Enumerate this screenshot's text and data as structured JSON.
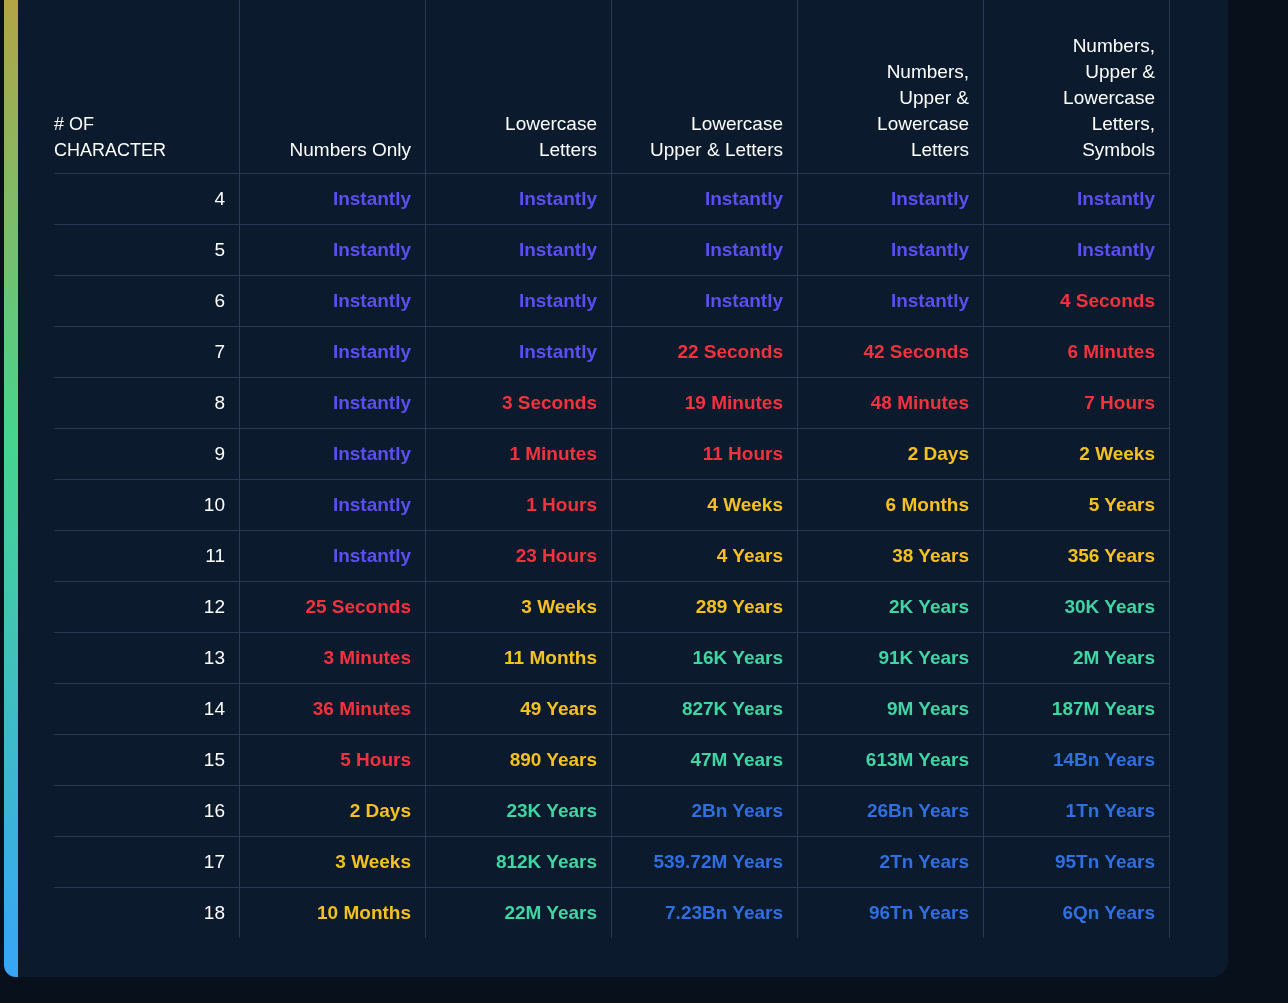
{
  "table": {
    "columns": [
      "# OF\nCHARACTER",
      "Numbers Only",
      "Lowercase\nLetters",
      "Lowercase\nUpper & Letters",
      "Numbers,\nUpper &\nLowercase\nLetters",
      "Numbers,\nUpper &\nLowercase\nLetters,\nSymbols"
    ],
    "rows": [
      {
        "cells": [
          {
            "text": "4",
            "color": "#ffffff"
          },
          {
            "text": "Instantly",
            "color": "#5b4ef2"
          },
          {
            "text": "Instantly",
            "color": "#5b4ef2"
          },
          {
            "text": "Instantly",
            "color": "#5b4ef2"
          },
          {
            "text": "Instantly",
            "color": "#5b4ef2"
          },
          {
            "text": "Instantly",
            "color": "#5b4ef2"
          }
        ]
      },
      {
        "cells": [
          {
            "text": "5",
            "color": "#ffffff"
          },
          {
            "text": "Instantly",
            "color": "#5b4ef2"
          },
          {
            "text": "Instantly",
            "color": "#5b4ef2"
          },
          {
            "text": "Instantly",
            "color": "#5b4ef2"
          },
          {
            "text": "Instantly",
            "color": "#5b4ef2"
          },
          {
            "text": "Instantly",
            "color": "#5b4ef2"
          }
        ]
      },
      {
        "cells": [
          {
            "text": "6",
            "color": "#ffffff"
          },
          {
            "text": "Instantly",
            "color": "#5b4ef2"
          },
          {
            "text": "Instantly",
            "color": "#5b4ef2"
          },
          {
            "text": "Instantly",
            "color": "#5b4ef2"
          },
          {
            "text": "Instantly",
            "color": "#5b4ef2"
          },
          {
            "text": "4 Seconds",
            "color": "#f2323c"
          }
        ]
      },
      {
        "cells": [
          {
            "text": "7",
            "color": "#ffffff"
          },
          {
            "text": "Instantly",
            "color": "#5b4ef2"
          },
          {
            "text": "Instantly",
            "color": "#5b4ef2"
          },
          {
            "text": "22 Seconds",
            "color": "#f2323c"
          },
          {
            "text": "42 Seconds",
            "color": "#f2323c"
          },
          {
            "text": "6 Minutes",
            "color": "#f2323c"
          }
        ]
      },
      {
        "cells": [
          {
            "text": "8",
            "color": "#ffffff"
          },
          {
            "text": "Instantly",
            "color": "#5b4ef2"
          },
          {
            "text": "3 Seconds",
            "color": "#f2323c"
          },
          {
            "text": "19 Minutes",
            "color": "#f2323c"
          },
          {
            "text": "48 Minutes",
            "color": "#f2323c"
          },
          {
            "text": "7 Hours",
            "color": "#f2323c"
          }
        ]
      },
      {
        "cells": [
          {
            "text": "9",
            "color": "#ffffff"
          },
          {
            "text": "Instantly",
            "color": "#5b4ef2"
          },
          {
            "text": "1 Minutes",
            "color": "#f2323c"
          },
          {
            "text": "11 Hours",
            "color": "#f2323c"
          },
          {
            "text": "2 Days",
            "color": "#f5c11f"
          },
          {
            "text": "2 Weeks",
            "color": "#f5c11f"
          }
        ]
      },
      {
        "cells": [
          {
            "text": "10",
            "color": "#ffffff"
          },
          {
            "text": "Instantly",
            "color": "#5b4ef2"
          },
          {
            "text": "1 Hours",
            "color": "#f2323c"
          },
          {
            "text": "4 Weeks",
            "color": "#f5c11f"
          },
          {
            "text": "6 Months",
            "color": "#f5c11f"
          },
          {
            "text": "5 Years",
            "color": "#f5c11f"
          }
        ]
      },
      {
        "cells": [
          {
            "text": "11",
            "color": "#ffffff"
          },
          {
            "text": "Instantly",
            "color": "#5b4ef2"
          },
          {
            "text": "23 Hours",
            "color": "#f2323c"
          },
          {
            "text": "4 Years",
            "color": "#f5c11f"
          },
          {
            "text": "38 Years",
            "color": "#f5c11f"
          },
          {
            "text": "356 Years",
            "color": "#f5c11f"
          }
        ]
      },
      {
        "cells": [
          {
            "text": "12",
            "color": "#ffffff"
          },
          {
            "text": "25 Seconds",
            "color": "#f2323c"
          },
          {
            "text": "3 Weeks",
            "color": "#f5c11f"
          },
          {
            "text": "289 Years",
            "color": "#f5c11f"
          },
          {
            "text": "2K Years",
            "color": "#3ed6a2"
          },
          {
            "text": "30K Years",
            "color": "#3ed6a2"
          }
        ]
      },
      {
        "cells": [
          {
            "text": "13",
            "color": "#ffffff"
          },
          {
            "text": "3 Minutes",
            "color": "#f2323c"
          },
          {
            "text": "11 Months",
            "color": "#f5c11f"
          },
          {
            "text": "16K Years",
            "color": "#3ed6a2"
          },
          {
            "text": "91K Years",
            "color": "#3ed6a2"
          },
          {
            "text": "2M Years",
            "color": "#3ed6a2"
          }
        ]
      },
      {
        "cells": [
          {
            "text": "14",
            "color": "#ffffff"
          },
          {
            "text": "36 Minutes",
            "color": "#f2323c"
          },
          {
            "text": "49 Years",
            "color": "#f5c11f"
          },
          {
            "text": "827K Years",
            "color": "#3ed6a2"
          },
          {
            "text": "9M Years",
            "color": "#3ed6a2"
          },
          {
            "text": "187M Years",
            "color": "#3ed6a2"
          }
        ]
      },
      {
        "cells": [
          {
            "text": "15",
            "color": "#ffffff"
          },
          {
            "text": "5 Hours",
            "color": "#f2323c"
          },
          {
            "text": "890 Years",
            "color": "#f5c11f"
          },
          {
            "text": "47M Years",
            "color": "#3ed6a2"
          },
          {
            "text": "613M Years",
            "color": "#3ed6a2"
          },
          {
            "text": "14Bn Years",
            "color": "#2f6fe2"
          }
        ]
      },
      {
        "cells": [
          {
            "text": "16",
            "color": "#ffffff"
          },
          {
            "text": "2 Days",
            "color": "#f5c11f"
          },
          {
            "text": "23K Years",
            "color": "#3ed6a2"
          },
          {
            "text": "2Bn Years",
            "color": "#2f6fe2"
          },
          {
            "text": "26Bn Years",
            "color": "#2f6fe2"
          },
          {
            "text": "1Tn Years",
            "color": "#2f6fe2"
          }
        ]
      },
      {
        "cells": [
          {
            "text": "17",
            "color": "#ffffff"
          },
          {
            "text": "3 Weeks",
            "color": "#f5c11f"
          },
          {
            "text": "812K Years",
            "color": "#3ed6a2"
          },
          {
            "text": "539.72M Years",
            "color": "#2f6fe2"
          },
          {
            "text": "2Tn Years",
            "color": "#2f6fe2"
          },
          {
            "text": "95Tn Years",
            "color": "#2f6fe2"
          }
        ]
      },
      {
        "cells": [
          {
            "text": "18",
            "color": "#ffffff"
          },
          {
            "text": "10 Months",
            "color": "#f5c11f"
          },
          {
            "text": "22M Years",
            "color": "#3ed6a2"
          },
          {
            "text": "7.23Bn Years",
            "color": "#2f6fe2"
          },
          {
            "text": "96Tn Years",
            "color": "#2f6fe2"
          },
          {
            "text": "6Qn Years",
            "color": "#2f6fe2"
          }
        ]
      }
    ]
  }
}
